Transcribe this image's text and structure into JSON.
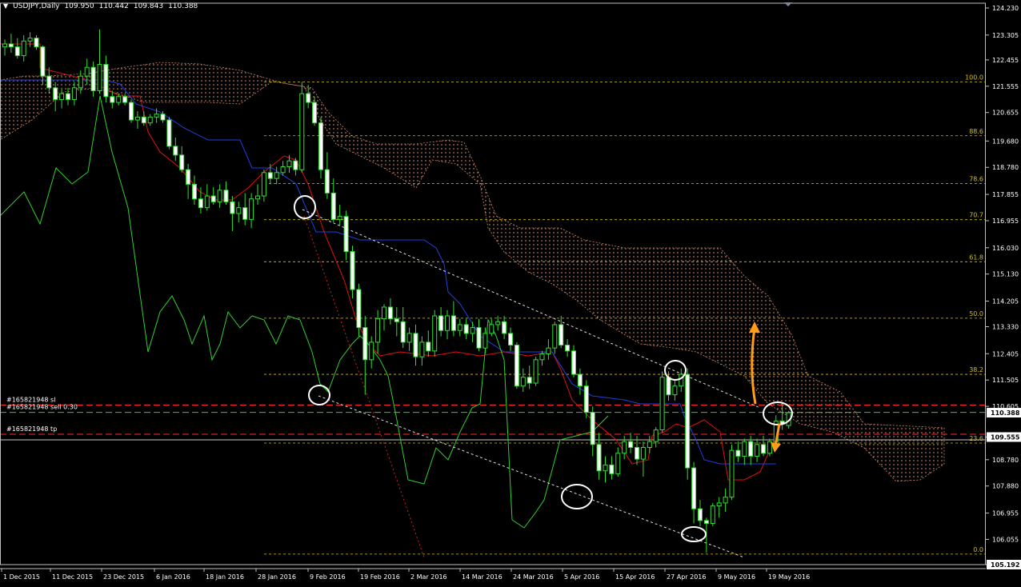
{
  "window": {
    "symbol_label": "USDJPY,Daily",
    "ohlc": [
      "109.950",
      "110.442",
      "109.843",
      "110.388"
    ]
  },
  "chart_data": {
    "type": "candlestick",
    "symbol": "USDJPY",
    "timeframe": "Daily",
    "ylim": [
      105.192,
      124.23
    ],
    "x_ticks": [
      "1 Dec 2015",
      "11 Dec 2015",
      "23 Dec 2015",
      "6 Jan 2016",
      "18 Jan 2016",
      "28 Jan 2016",
      "9 Feb 2016",
      "19 Feb 2016",
      "2 Mar 2016",
      "14 Mar 2016",
      "24 Mar 2016",
      "5 Apr 2016",
      "15 Apr 2016",
      "27 Apr 2016",
      "9 May 2016",
      "19 May 2016"
    ],
    "y_ticks": [
      124.23,
      123.305,
      122.455,
      121.555,
      120.655,
      119.68,
      118.78,
      117.855,
      116.955,
      116.03,
      115.13,
      114.205,
      113.33,
      112.405,
      111.505,
      110.605,
      109.555,
      108.78,
      107.88,
      106.955,
      106.055,
      105.192
    ],
    "current_price": "110.388",
    "tp_price": "109.555",
    "bottom_price": "105.192",
    "fib_levels": [
      {
        "label": "100.0",
        "price": 121.7
      },
      {
        "label": "88.6",
        "price": 119.86
      },
      {
        "label": "78.6",
        "price": 118.23
      },
      {
        "label": "70.7",
        "price": 116.99
      },
      {
        "label": "61.8",
        "price": 115.55
      },
      {
        "label": "50.0",
        "price": 113.62
      },
      {
        "label": "38.2",
        "price": 111.7
      },
      {
        "label": "23.6",
        "price": 109.35
      },
      {
        "label": "0.0",
        "price": 105.55
      }
    ],
    "orders": [
      {
        "label": "#165821948 sl",
        "price": 110.65,
        "color": "#ff2a2a"
      },
      {
        "label": "#165821948 sell 0.30",
        "price": 110.4,
        "color": "#2ad02a"
      },
      {
        "label": "#165821948 tp",
        "price": 109.65,
        "color": "#ff2a2a"
      }
    ],
    "candles": [
      [
        122.9,
        123.15,
        122.6,
        123.0
      ],
      [
        123.0,
        123.35,
        122.7,
        122.9
      ],
      [
        122.9,
        123.2,
        122.5,
        122.6
      ],
      [
        122.6,
        123.3,
        122.4,
        123.1
      ],
      [
        123.1,
        123.4,
        122.9,
        123.2
      ],
      [
        123.2,
        123.3,
        122.8,
        122.9
      ],
      [
        122.9,
        122.95,
        121.6,
        121.9
      ],
      [
        121.9,
        122.2,
        121.3,
        121.5
      ],
      [
        121.5,
        121.7,
        120.7,
        121.1
      ],
      [
        121.1,
        121.5,
        120.8,
        121.3
      ],
      [
        121.3,
        121.5,
        120.9,
        121.1
      ],
      [
        121.1,
        121.7,
        120.9,
        121.5
      ],
      [
        121.5,
        122.1,
        121.3,
        121.9
      ],
      [
        121.9,
        122.5,
        121.6,
        122.2
      ],
      [
        122.2,
        122.4,
        121.2,
        121.4
      ],
      [
        121.4,
        123.5,
        121.3,
        122.3
      ],
      [
        122.3,
        122.6,
        121.0,
        121.2
      ],
      [
        121.2,
        121.4,
        120.8,
        121.0
      ],
      [
        121.0,
        121.3,
        120.9,
        121.2
      ],
      [
        121.2,
        121.3,
        120.9,
        121.0
      ],
      [
        121.0,
        121.1,
        120.3,
        120.4
      ],
      [
        120.4,
        120.7,
        120.1,
        120.5
      ],
      [
        120.5,
        120.7,
        120.2,
        120.3
      ],
      [
        120.3,
        120.6,
        120.2,
        120.5
      ],
      [
        120.5,
        120.8,
        120.3,
        120.6
      ],
      [
        120.6,
        120.7,
        120.3,
        120.4
      ],
      [
        120.4,
        120.5,
        119.4,
        119.5
      ],
      [
        119.5,
        119.8,
        119.0,
        119.2
      ],
      [
        119.2,
        119.5,
        118.6,
        118.7
      ],
      [
        118.7,
        118.9,
        117.7,
        118.2
      ],
      [
        118.2,
        118.5,
        117.5,
        117.7
      ],
      [
        117.7,
        118.1,
        117.2,
        117.4
      ],
      [
        117.4,
        118.2,
        117.3,
        117.8
      ],
      [
        117.8,
        118.1,
        117.5,
        117.6
      ],
      [
        117.6,
        118.2,
        117.4,
        118.0
      ],
      [
        118.0,
        118.3,
        117.5,
        117.6
      ],
      [
        117.6,
        117.8,
        116.6,
        117.2
      ],
      [
        117.2,
        117.6,
        116.9,
        117.4
      ],
      [
        117.4,
        117.9,
        116.8,
        117.0
      ],
      [
        117.0,
        117.9,
        116.7,
        117.7
      ],
      [
        117.7,
        118.2,
        117.5,
        117.8
      ],
      [
        117.8,
        118.7,
        117.6,
        118.6
      ],
      [
        118.6,
        118.9,
        118.2,
        118.4
      ],
      [
        118.4,
        118.8,
        118.2,
        118.6
      ],
      [
        118.6,
        119.0,
        118.5,
        118.8
      ],
      [
        118.8,
        119.2,
        118.6,
        119.0
      ],
      [
        119.0,
        119.1,
        118.5,
        118.7
      ],
      [
        118.7,
        121.7,
        118.6,
        121.3
      ],
      [
        121.3,
        121.6,
        120.8,
        121.0
      ],
      [
        121.0,
        121.2,
        120.2,
        120.3
      ],
      [
        120.3,
        120.5,
        118.4,
        118.7
      ],
      [
        118.7,
        119.3,
        117.7,
        117.9
      ],
      [
        117.9,
        118.4,
        116.9,
        117.0
      ],
      [
        117.0,
        117.5,
        116.8,
        117.1
      ],
      [
        117.1,
        117.3,
        115.6,
        115.9
      ],
      [
        115.9,
        116.1,
        114.3,
        114.6
      ],
      [
        114.6,
        114.8,
        113.0,
        113.3
      ],
      [
        113.3,
        113.7,
        111.0,
        112.2
      ],
      [
        112.2,
        113.0,
        111.9,
        112.8
      ],
      [
        112.8,
        113.9,
        112.4,
        113.6
      ],
      [
        113.6,
        114.1,
        113.2,
        114.0
      ],
      [
        114.0,
        114.3,
        113.4,
        113.6
      ],
      [
        113.6,
        114.0,
        113.0,
        113.5
      ],
      [
        113.5,
        114.0,
        112.6,
        112.8
      ],
      [
        112.8,
        113.3,
        112.5,
        113.1
      ],
      [
        113.1,
        113.4,
        112.0,
        112.3
      ],
      [
        112.3,
        113.0,
        112.0,
        112.8
      ],
      [
        112.8,
        113.2,
        112.3,
        112.5
      ],
      [
        112.5,
        113.9,
        112.3,
        113.7
      ],
      [
        113.7,
        114.0,
        113.0,
        113.2
      ],
      [
        113.2,
        113.9,
        112.9,
        113.7
      ],
      [
        113.7,
        114.2,
        113.0,
        113.2
      ],
      [
        113.2,
        113.6,
        113.0,
        113.4
      ],
      [
        113.4,
        113.6,
        112.9,
        113.1
      ],
      [
        113.1,
        113.5,
        112.8,
        113.3
      ],
      [
        113.3,
        113.6,
        112.5,
        112.6
      ],
      [
        112.6,
        113.3,
        112.4,
        113.1
      ],
      [
        113.1,
        113.6,
        113.0,
        113.4
      ],
      [
        113.4,
        113.7,
        113.2,
        113.5
      ],
      [
        113.5,
        113.7,
        112.9,
        113.1
      ],
      [
        113.1,
        113.3,
        112.5,
        112.7
      ],
      [
        112.7,
        112.8,
        111.2,
        111.3
      ],
      [
        111.3,
        111.9,
        111.1,
        111.6
      ],
      [
        111.6,
        112.0,
        111.2,
        111.4
      ],
      [
        111.4,
        112.3,
        111.3,
        112.2
      ],
      [
        112.2,
        112.5,
        112.0,
        112.4
      ],
      [
        112.4,
        112.9,
        112.2,
        112.6
      ],
      [
        112.6,
        113.5,
        112.4,
        113.4
      ],
      [
        113.4,
        113.7,
        112.6,
        112.7
      ],
      [
        112.7,
        112.9,
        112.3,
        112.5
      ],
      [
        112.5,
        112.7,
        111.6,
        111.7
      ],
      [
        111.7,
        111.9,
        111.0,
        111.3
      ],
      [
        111.3,
        111.5,
        110.2,
        110.4
      ],
      [
        110.4,
        110.6,
        108.9,
        109.3
      ],
      [
        109.3,
        109.7,
        108.1,
        108.4
      ],
      [
        108.4,
        108.9,
        108.0,
        108.6
      ],
      [
        108.6,
        108.9,
        108.1,
        108.3
      ],
      [
        108.3,
        109.2,
        108.2,
        109.0
      ],
      [
        109.0,
        109.6,
        108.8,
        109.4
      ],
      [
        109.4,
        109.7,
        109.0,
        109.2
      ],
      [
        109.2,
        109.6,
        108.6,
        108.8
      ],
      [
        108.8,
        109.4,
        108.2,
        109.2
      ],
      [
        109.2,
        109.6,
        109.0,
        109.4
      ],
      [
        109.4,
        109.9,
        109.2,
        109.8
      ],
      [
        109.8,
        111.8,
        109.7,
        111.6
      ],
      [
        111.6,
        111.8,
        110.8,
        111.0
      ],
      [
        111.0,
        111.5,
        110.8,
        111.3
      ],
      [
        111.3,
        111.9,
        111.1,
        111.7
      ],
      [
        111.7,
        111.9,
        108.1,
        108.5
      ],
      [
        108.5,
        108.7,
        106.6,
        107.1
      ],
      [
        107.1,
        107.4,
        106.5,
        106.7
      ],
      [
        106.7,
        106.8,
        105.6,
        106.6
      ],
      [
        106.6,
        107.3,
        106.5,
        107.2
      ],
      [
        107.2,
        107.5,
        106.8,
        107.3
      ],
      [
        107.3,
        107.8,
        107.0,
        107.5
      ],
      [
        107.5,
        109.3,
        107.4,
        109.1
      ],
      [
        109.1,
        109.4,
        108.7,
        108.9
      ],
      [
        108.9,
        109.5,
        108.6,
        109.4
      ],
      [
        109.4,
        109.6,
        108.6,
        108.9
      ],
      [
        108.9,
        109.5,
        108.7,
        109.3
      ],
      [
        109.3,
        109.6,
        108.9,
        109.0
      ],
      [
        109.0,
        109.5,
        108.9,
        109.4
      ],
      [
        109.4,
        110.3,
        109.2,
        110.1
      ],
      [
        110.1,
        110.7,
        109.8,
        110.0
      ],
      [
        109.95,
        110.442,
        109.843,
        110.388
      ]
    ]
  }
}
